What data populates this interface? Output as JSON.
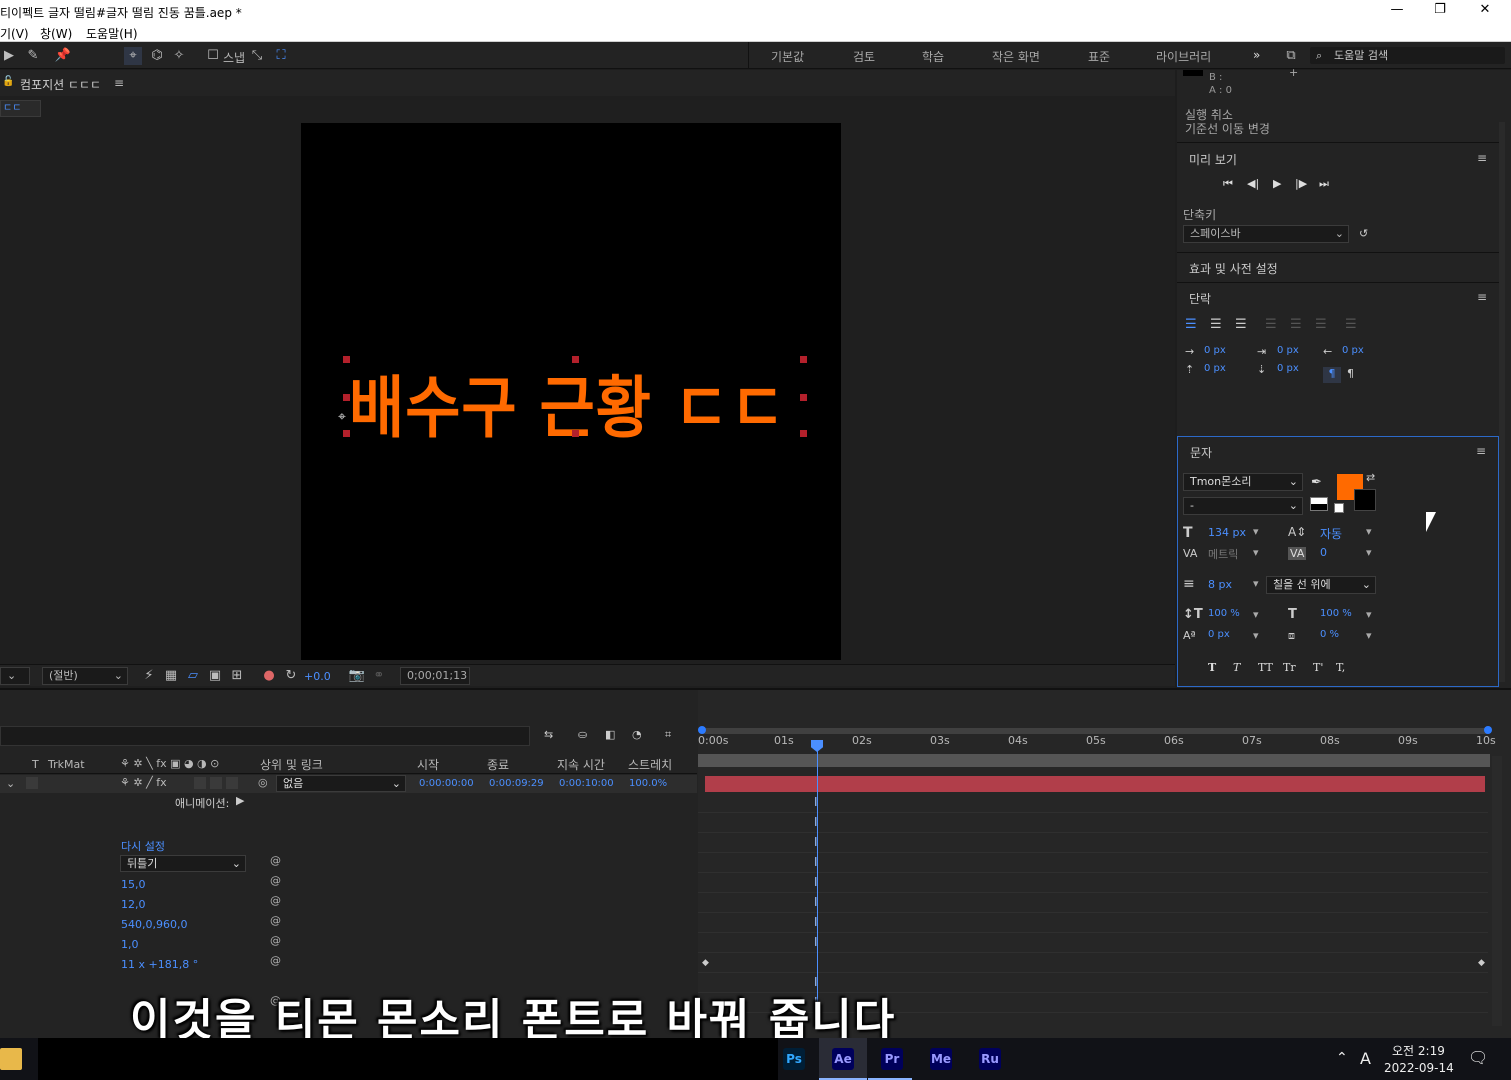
{
  "window": {
    "title": "티이펙트 글자 떨림#글자 떨림 진동 꿈틀.aep *",
    "minimize": "—",
    "restore": "❐",
    "close": "✕"
  },
  "menu": [
    "기(V)",
    "창(W)",
    "도움말(H)"
  ],
  "toolbar": {
    "snap_label": "스냅",
    "workspaces": [
      "기본값",
      "검토",
      "학습",
      "작은 화면",
      "표준",
      "라이브러리"
    ],
    "more": "»",
    "search_placeholder": "도움말 검색"
  },
  "composition": {
    "tab_label": "컴포지션 ㄷㄷㄷ",
    "flow_tab": "ㄷㄷ",
    "canvas_text": "배수구 근황 ㄷㄷ",
    "resolution": "(절반)",
    "exposure": "+0.0",
    "timecode": "0;00;01;13"
  },
  "info_panel": {
    "b_label": "B :",
    "a_label": "A : 0",
    "undo": "실행 취소",
    "undo_item": "기준선 이동 변경"
  },
  "preview": {
    "title": "미리 보기",
    "shortcut_label": "단축키",
    "shortcut_value": "스페이스바",
    "effects_title": "효과 및 사전 설정"
  },
  "paragraph": {
    "title": "단락",
    "values": [
      "0 px",
      "0 px",
      "0 px",
      "0 px",
      "0 px"
    ]
  },
  "character": {
    "title": "문자",
    "font": "Tmon몬소리",
    "style": "-",
    "font_size": "134 px",
    "leading": "자동",
    "kerning": "메트릭",
    "tracking": "0",
    "stroke_width": "8 px",
    "stroke_mode": "칠을 선 위에",
    "v_scale": "100 %",
    "h_scale": "100 %",
    "baseline": "0 px",
    "tsume": "0 %",
    "fill_color": "#ff6a00",
    "styles": [
      "T",
      "T",
      "TT",
      "Tr",
      "T'",
      "T,"
    ]
  },
  "timeline": {
    "columns": [
      "T",
      "TrkMat",
      "상위 및 링크",
      "시작",
      "종료",
      "지속 시간",
      "스트레치"
    ],
    "layer": {
      "parent": "없음",
      "in": "0:00:00:00",
      "out": "0:00:09:29",
      "duration": "0:00:10:00",
      "stretch": "100.0%"
    },
    "animate_label": "애니메이션:",
    "reset_label": "다시 설정",
    "dropdown": "뒤틀기",
    "values": [
      "15,0",
      "12,0",
      "540,0,960,0",
      "1,0",
      "11 x +181,8 °"
    ],
    "ruler": [
      "0:00s",
      "01s",
      "02s",
      "03s",
      "04s",
      "05s",
      "06s",
      "07s",
      "08s",
      "09s",
      "10s"
    ]
  },
  "subtitle": "이것을 티몬 몬소리 폰트로 바꿔 줍니다",
  "taskbar": {
    "apps": [
      "Ps",
      "Ae",
      "Pr",
      "Me",
      "Ru"
    ],
    "ime": "A",
    "time": "오전 2:19",
    "date": "2022-09-14"
  }
}
